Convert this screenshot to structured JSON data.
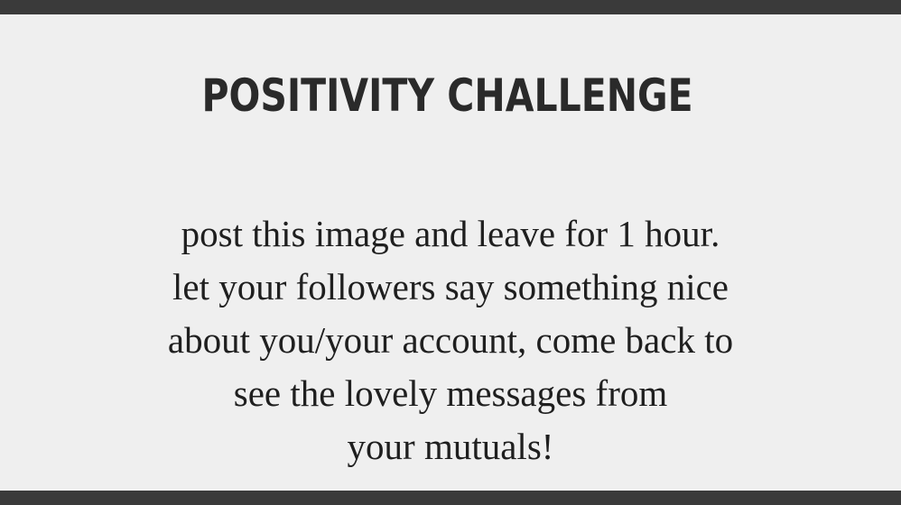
{
  "title": "POSITIVITY CHALLENGE",
  "body_lines": [
    "post this image and leave for 1 hour.",
    "let your followers say something nice",
    "about you/your account, come back to",
    "see the lovely messages from",
    "your mutuals!"
  ],
  "colors": {
    "border": "#3a3a3a",
    "card_background": "#efefef",
    "text": "#2a2a2a"
  }
}
